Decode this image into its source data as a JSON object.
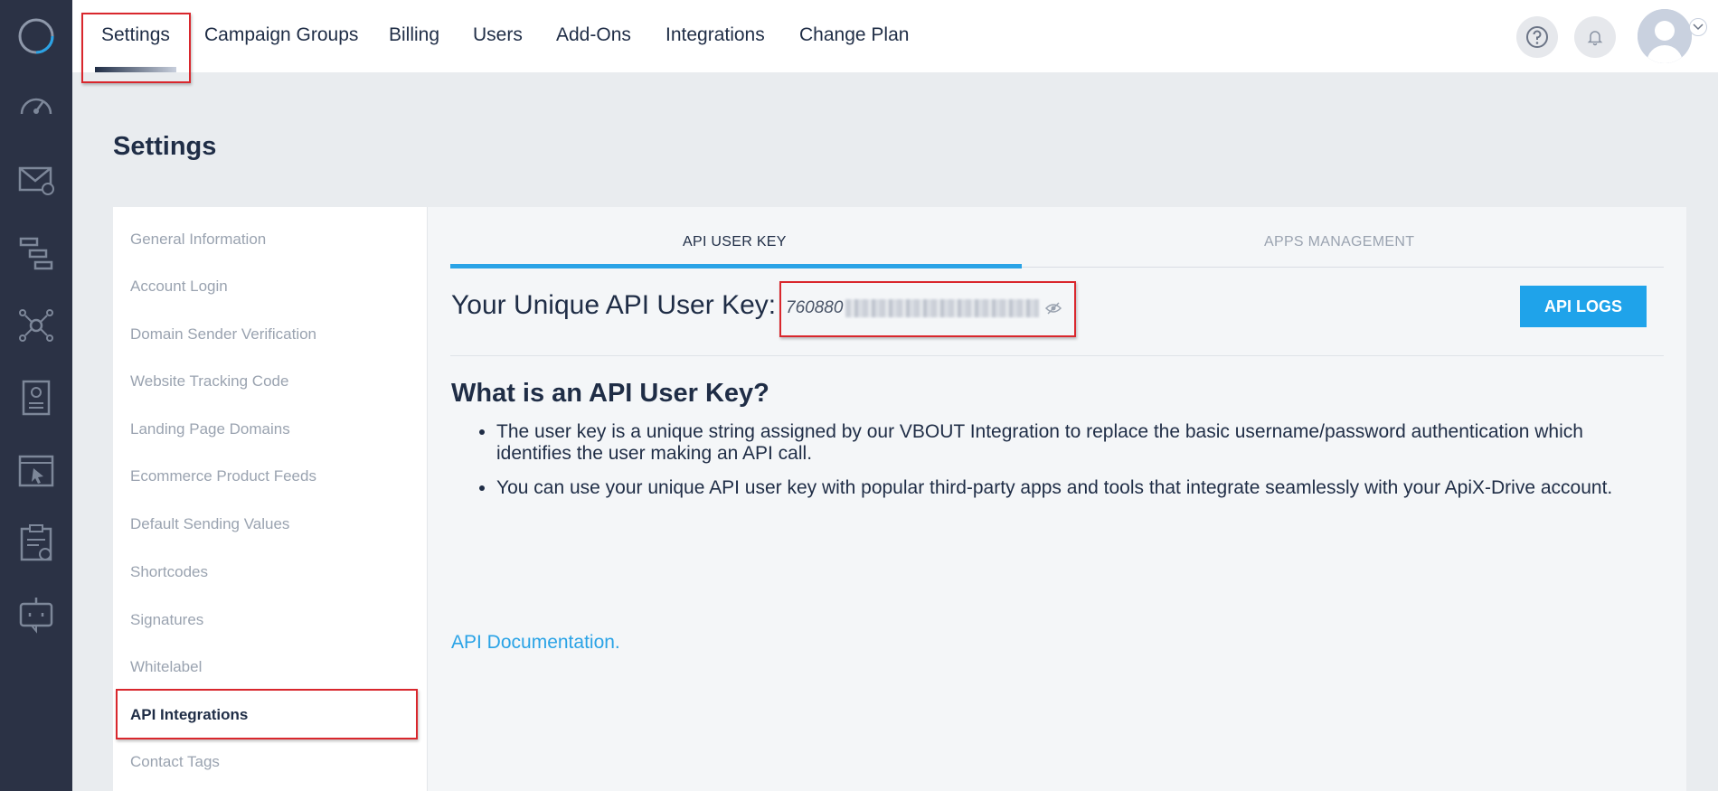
{
  "topnav": {
    "tabs": [
      {
        "label": "Settings",
        "active": true
      },
      {
        "label": "Campaign Groups"
      },
      {
        "label": "Billing"
      },
      {
        "label": "Users"
      },
      {
        "label": "Add-Ons"
      },
      {
        "label": "Integrations"
      },
      {
        "label": "Change Plan"
      }
    ],
    "icons": [
      "help-icon",
      "bell-icon",
      "avatar",
      "chevron-down-icon"
    ]
  },
  "rail": {
    "icons": [
      "logo-icon",
      "dashboard-gauge-icon",
      "email-icon",
      "workflow-icon",
      "network-icon",
      "contacts-icon",
      "browser-cursor-icon",
      "clipboard-icon",
      "bot-icon"
    ]
  },
  "page": {
    "title": "Settings"
  },
  "sidebar": {
    "items": [
      {
        "label": "General Information"
      },
      {
        "label": "Account Login"
      },
      {
        "label": "Domain Sender Verification"
      },
      {
        "label": "Website Tracking Code"
      },
      {
        "label": "Landing Page Domains"
      },
      {
        "label": "Ecommerce Product Feeds"
      },
      {
        "label": "Default Sending Values"
      },
      {
        "label": "Shortcodes"
      },
      {
        "label": "Signatures"
      },
      {
        "label": "Whitelabel"
      },
      {
        "label": "API Integrations",
        "active": true
      },
      {
        "label": "Contact Tags"
      }
    ]
  },
  "content": {
    "tabs": [
      {
        "label": "API USER KEY",
        "active": true
      },
      {
        "label": "APPS MANAGEMENT"
      }
    ],
    "key_label": "Your Unique API User Key:",
    "key_prefix": "760880",
    "api_logs_label": "API LOGS",
    "what_title": "What is an API User Key?",
    "bullets": [
      "The user key is a unique string assigned by our VBOUT Integration to replace the basic username/password authentication which identifies the user making an API call.",
      "You can use your unique API user key with popular third-party apps and tools that integrate seamlessly with your ApiX-Drive account."
    ],
    "doc_link": "API Documentation."
  },
  "colors": {
    "rail_bg": "#2b3245",
    "accent_blue": "#2aa3e6",
    "button_blue": "#1fa3ea",
    "highlight_red": "#d9272d",
    "text_dark": "#1f2d46",
    "text_muted": "#9aa3b0"
  }
}
